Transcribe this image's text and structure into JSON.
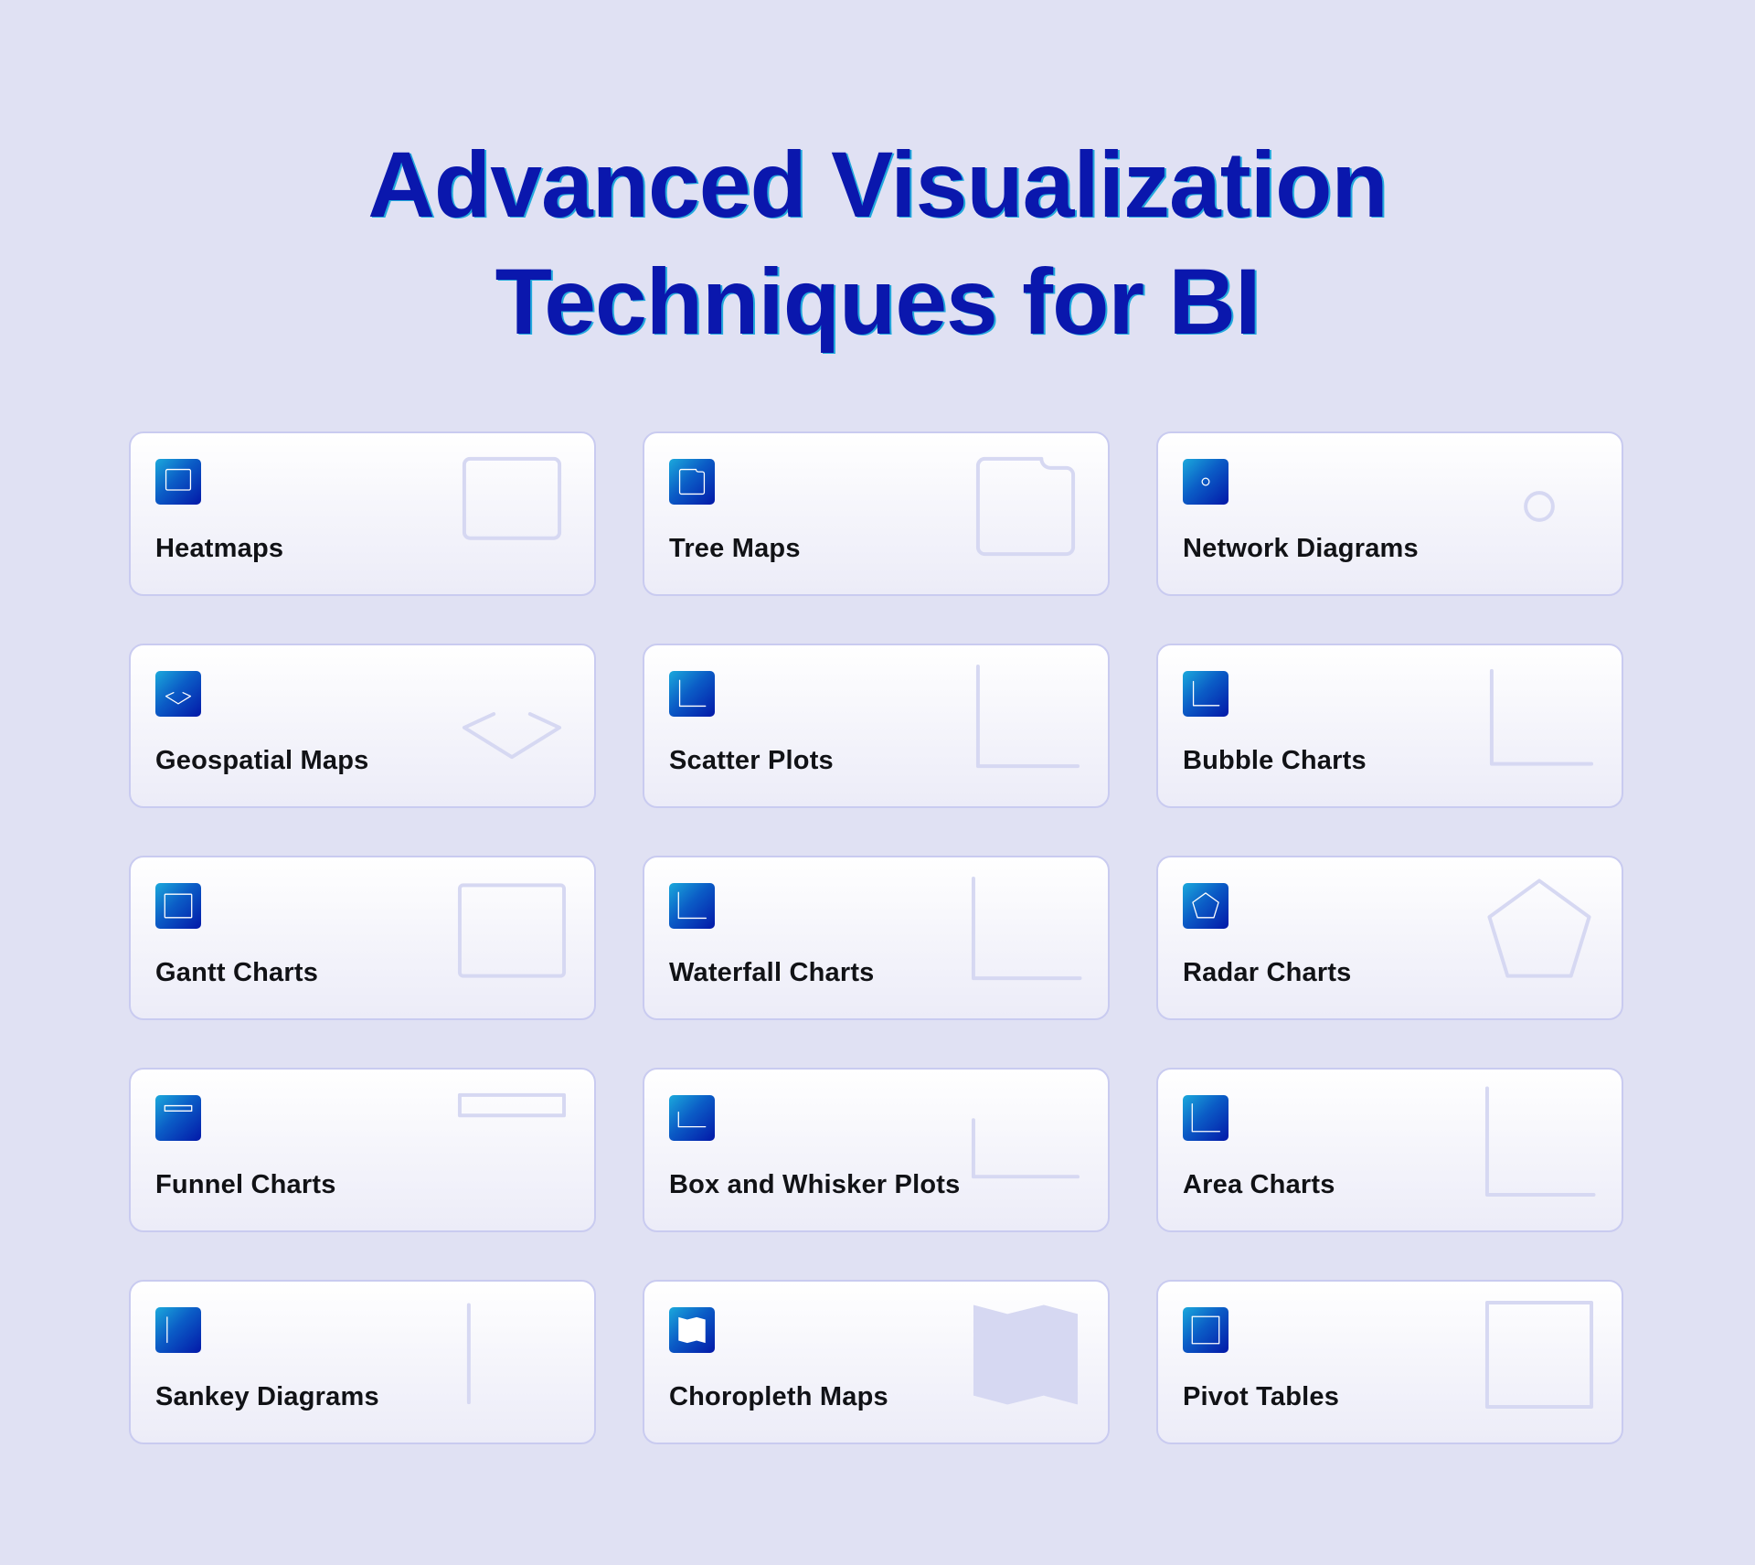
{
  "title": {
    "line1": "Advanced Visualization",
    "line2": "Techniques for BI"
  },
  "colors": {
    "background": "#e0e1f3",
    "title": "#0a17ad",
    "title_shadow": "#22a9dc",
    "badge_gradient_start": "#1ba9dc",
    "badge_gradient_end": "#0318a8",
    "ghost_icon": "#d6d8f2",
    "card_border": "#c9cbf0",
    "label": "#111216"
  },
  "cards": [
    {
      "label": "Heatmaps",
      "icon": "heatmap-icon"
    },
    {
      "label": "Tree Maps",
      "icon": "tree-map-icon"
    },
    {
      "label": "Network Diagrams",
      "icon": "network-icon"
    },
    {
      "label": "Geospatial Maps",
      "icon": "geospatial-map-icon"
    },
    {
      "label": "Scatter Plots",
      "icon": "scatter-plot-icon"
    },
    {
      "label": "Bubble Charts",
      "icon": "bubble-chart-icon"
    },
    {
      "label": "Gantt Charts",
      "icon": "gantt-chart-icon"
    },
    {
      "label": "Waterfall Charts",
      "icon": "waterfall-chart-icon"
    },
    {
      "label": "Radar Charts",
      "icon": "radar-chart-icon"
    },
    {
      "label": "Funnel Charts",
      "icon": "funnel-chart-icon"
    },
    {
      "label": "Box and Whisker Plots",
      "icon": "box-whisker-icon"
    },
    {
      "label": "Area Charts",
      "icon": "area-chart-icon"
    },
    {
      "label": "Sankey Diagrams",
      "icon": "sankey-icon"
    },
    {
      "label": "Choropleth Maps",
      "icon": "choropleth-map-icon"
    },
    {
      "label": "Pivot Tables",
      "icon": "pivot-table-icon"
    }
  ]
}
